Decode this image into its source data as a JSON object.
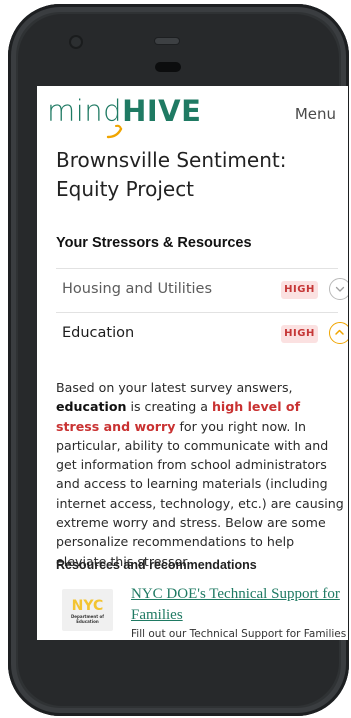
{
  "app": {
    "logo_mind": "mind",
    "logo_hive": "HIVE",
    "menu_label": "Menu"
  },
  "project": {
    "title": "Brownsville Sentiment: Equity Project"
  },
  "stressors": {
    "heading": "Your Stressors & Resources",
    "items": [
      {
        "label": "Housing and Utilities",
        "level": "HIGH",
        "expanded": false
      },
      {
        "label": "Education",
        "level": "HIGH",
        "expanded": true
      }
    ]
  },
  "detail": {
    "p1": "Based on your latest survey answers, ",
    "kw": "education",
    "p2": " is creating a ",
    "hl": "high level of stress and worry",
    "p3": " for you right now. In particular, ability to communicate with and get information from school administrators and access to learning materials (including internet access, technology, etc.) are causing extreme worry and stress. Below are some personalize recommendations to help eleviate this stressor."
  },
  "resources": {
    "heading": "Resources and recommendations",
    "items": [
      {
        "title": "NYC DOE's Technical Support for Families",
        "snippet": "Fill out our Technical Support for Families",
        "logo_text": "NYC",
        "logo_sub1": "Department of",
        "logo_sub2": "Education"
      }
    ]
  },
  "colors": {
    "brand_green": "#1f7a63",
    "accent_orange": "#f0a500",
    "high_badge_bg": "#fbe1e1",
    "high_badge_text": "#c53737",
    "highlight_red": "#c93232",
    "nyc_logo_yellow": "#f3c431"
  },
  "icons": {
    "collapsed_toggle": "chevron-down-icon",
    "expanded_toggle": "chevron-up-icon"
  }
}
